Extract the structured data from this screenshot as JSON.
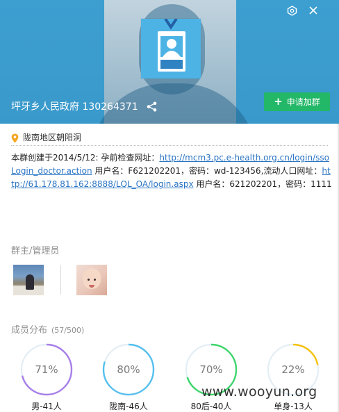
{
  "header": {
    "group_name": "坪牙乡人民政府",
    "group_id": "130264371",
    "join_label": "申请加群",
    "settings_icon": "settings-icon",
    "close_icon": "close-icon",
    "share_icon": "share-icon"
  },
  "location": {
    "text": "陇南地区朝阳洞",
    "icon": "location-pin-icon",
    "color": "#f5a623"
  },
  "description": {
    "part1": "本群创建于2014/5/12: 孕前检查网址：",
    "link1": "http://mcm3.pc.e-health.org.cn/login/ssoLogin_doctor.action",
    "part2": " 用户名：F621202201，密码：wd-123456,流动人口网址：",
    "link2": "http://61.178.81.162:8888/LQL_OA/login.aspx",
    "part3": " 用户名：621202201，密码：1111"
  },
  "admins": {
    "title": "群主/管理员"
  },
  "members": {
    "title": "成员分布",
    "count": "(57/500)",
    "stats": [
      {
        "percent_label": "71%",
        "value": 0.71,
        "label": "男-41人",
        "color": "#a77fe8"
      },
      {
        "percent_label": "80%",
        "value": 0.8,
        "label": "陇南-46人",
        "color": "#55c0ee"
      },
      {
        "percent_label": "70%",
        "value": 0.7,
        "label": "80后-40人",
        "color": "#3fd66d"
      },
      {
        "percent_label": "22%",
        "value": 0.22,
        "label": "单身-13人",
        "color": "#f4c20d"
      }
    ]
  },
  "watermark": "www.wooyun.org",
  "colors": {
    "header_bg": "#3a9bcd",
    "join_button": "#23b768",
    "link": "#2a74c4",
    "ring_track": "#e3eef5"
  }
}
